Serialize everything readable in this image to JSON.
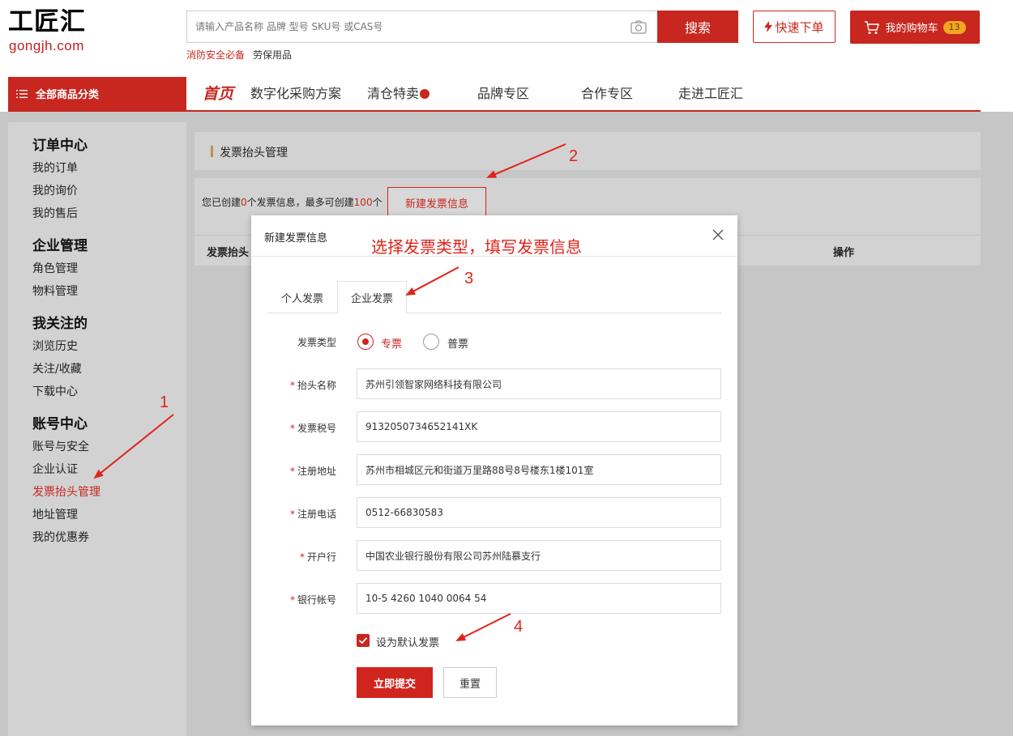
{
  "header": {
    "logo_main": "工匠汇",
    "logo_sub": "gongjh.com",
    "search_placeholder": "请输入产品名称 品牌 型号 SKU号 或CAS号",
    "search_button": "搜索",
    "hot_keywords": [
      "消防安全必备",
      "劳保用品"
    ],
    "quick_order": "快速下单",
    "cart_label": "我的购物车",
    "cart_count": "13"
  },
  "nav": {
    "category_button": "全部商品分类",
    "items": [
      "首页",
      "数字化采购方案",
      "清仓特卖",
      "品牌专区",
      "合作专区",
      "走进工匠汇"
    ]
  },
  "sidebar": {
    "groups": [
      {
        "title": "订单中心",
        "items": [
          "我的订单",
          "我的询价",
          "我的售后"
        ]
      },
      {
        "title": "企业管理",
        "items": [
          "角色管理",
          "物料管理"
        ]
      },
      {
        "title": "我关注的",
        "items": [
          "浏览历史",
          "关注/收藏",
          "下载中心"
        ]
      },
      {
        "title": "账号中心",
        "items": [
          "账号与安全",
          "企业认证",
          "发票抬头管理",
          "地址管理",
          "我的优惠券"
        ]
      }
    ],
    "active_item": "发票抬头管理"
  },
  "main": {
    "panel_title": "发票抬头管理",
    "info_prefix": "您已创建",
    "created_count": "0",
    "info_middle": "个发票信息，最多可创建",
    "max_count": "100",
    "info_suffix": "个",
    "new_invoice_button": "新建发票信息",
    "table_headers": [
      "发票抬头",
      "操作"
    ]
  },
  "modal": {
    "title": "新建发票信息",
    "tabs": [
      "个人发票",
      "企业发票"
    ],
    "active_tab": "企业发票",
    "invoice_type_label": "发票类型",
    "invoice_type_options": [
      "专票",
      "普票"
    ],
    "invoice_type_selected": "专票",
    "fields": [
      {
        "label": "抬头名称",
        "value": "苏州引领智家网络科技有限公司"
      },
      {
        "label": "发票税号",
        "value": "9132050734652141XK"
      },
      {
        "label": "注册地址",
        "value": "苏州市相城区元和街道万里路88号8号楼东1楼101室"
      },
      {
        "label": "注册电话",
        "value": "0512-66830583"
      },
      {
        "label": "开户行",
        "value": "中国农业银行股份有限公司苏州陆慕支行"
      },
      {
        "label": "银行帐号",
        "value": "10-5 4260 1040 0064 54"
      }
    ],
    "default_checkbox_label": "设为默认发票",
    "default_checked": true,
    "submit_button": "立即提交",
    "reset_button": "重置"
  },
  "annotations": {
    "instruction": "选择发票类型，填写发票信息",
    "step_numbers": [
      "1",
      "2",
      "3",
      "4"
    ],
    "color": "#e0231a"
  },
  "colors": {
    "brand_red": "#c7271f",
    "overlay_gray": "#c6c6c6"
  }
}
